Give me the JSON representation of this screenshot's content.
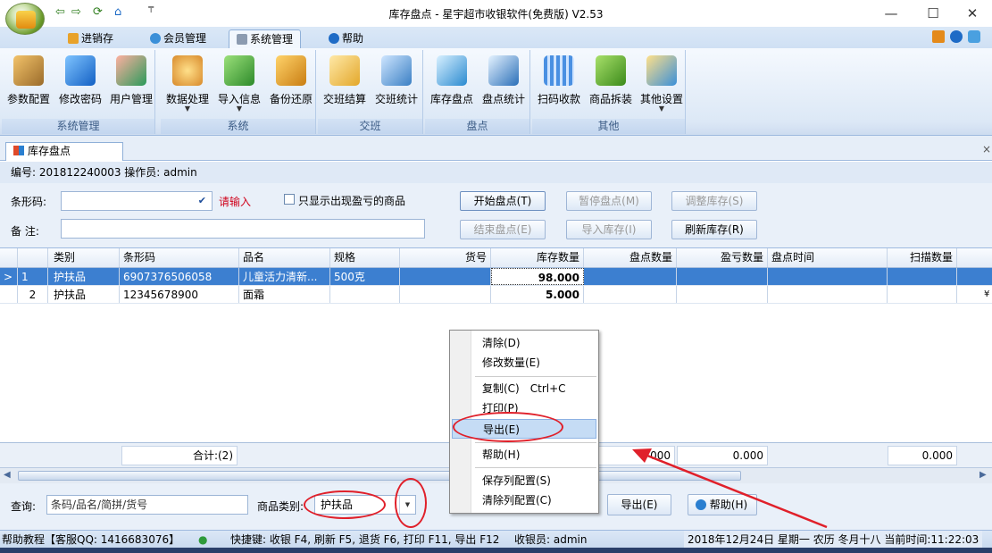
{
  "window": {
    "title": "库存盘点 - 星宇超市收银软件(免费版) V2.53",
    "controls": [
      "—",
      "☐",
      "✕"
    ],
    "quick_access": [
      "⇦",
      "⇨",
      "⟳",
      "⌂",
      "₸"
    ]
  },
  "menu": {
    "tabs": [
      "进销存",
      "会员管理",
      "系统管理",
      "帮助"
    ],
    "active": "系统管理"
  },
  "ribbon": {
    "groups": [
      {
        "caption": "系统管理",
        "buttons": [
          "参数配置",
          "修改密码",
          "用户管理"
        ]
      },
      {
        "caption": "系统",
        "buttons": [
          "数据处理",
          "导入信息",
          "备份还原"
        ]
      },
      {
        "caption": "交班",
        "buttons": [
          "交班结算",
          "交班统计"
        ]
      },
      {
        "caption": "盘点",
        "buttons": [
          "库存盘点",
          "盘点统计"
        ]
      },
      {
        "caption": "其他",
        "buttons": [
          "扫码收款",
          "商品拆装",
          "其他设置"
        ]
      }
    ]
  },
  "doc_tab": {
    "label": "库存盘点",
    "close": "×"
  },
  "info": "编号: 201812240003   操作员: admin",
  "form": {
    "barcode_label": "条形码:",
    "barcode_hint": "请输入",
    "only_loss_label": "只显示出现盈亏的商品",
    "remark_label": "备  注:",
    "buttons": {
      "start": "开始盘点(T)",
      "pause": "暂停盘点(M)",
      "adjust": "调整库存(S)",
      "end": "结束盘点(E)",
      "import": "导入库存(I)",
      "refresh": "刷新库存(R)"
    }
  },
  "grid": {
    "columns": [
      "类别",
      "条形码",
      "品名",
      "规格",
      "货号",
      "库存数量",
      "盘点数量",
      "盈亏数量",
      "盘点时间",
      "扫描数量"
    ],
    "rows": [
      {
        "idx": "1",
        "marker": ">",
        "category": "护扶品",
        "barcode": "6907376506058",
        "name": "儿童活力清新...",
        "spec": "500克",
        "code": "",
        "stock": "98.000",
        "count": "",
        "diff": "",
        "time": "",
        "scan": ""
      },
      {
        "idx": "2",
        "marker": "",
        "category": "护扶品",
        "barcode": "12345678900",
        "name": "面霜",
        "spec": "",
        "code": "",
        "stock": "5.000",
        "count": "",
        "diff": "",
        "time": "",
        "scan": "",
        "tail": "¥"
      }
    ]
  },
  "totals": {
    "label": "合计:(2)",
    "v1": "000",
    "v2": "0.000",
    "v3": "0.000"
  },
  "query": {
    "label": "查询:",
    "placeholder": "条码/品名/简拼/货号",
    "category_label": "商品类别:",
    "category_value": "护扶品",
    "export": "导出(E)",
    "help": "帮助(H)"
  },
  "context_menu": {
    "items": [
      "清除(D)",
      "修改数量(E)",
      "复制(C)",
      "打印(P)",
      "导出(E)",
      "帮助(H)",
      "保存列配置(S)",
      "清除列配置(C)"
    ],
    "copy_shortcut": "Ctrl+C",
    "highlighted": "导出(E)"
  },
  "status": {
    "left": "帮助教程【客服QQ: 1416683076】",
    "shortcuts": "快捷键: 收银 F4, 刷新 F5, 退货 F6, 打印 F11, 导出 F12",
    "cashier": "收银员: admin",
    "datetime": "2018年12月24日 星期一 农历 冬月十八 当前时间:11:22:03"
  },
  "colors": {
    "accent": "#3c7fd0",
    "annotation": "#e0202a",
    "hint_red": "#d0021b"
  }
}
